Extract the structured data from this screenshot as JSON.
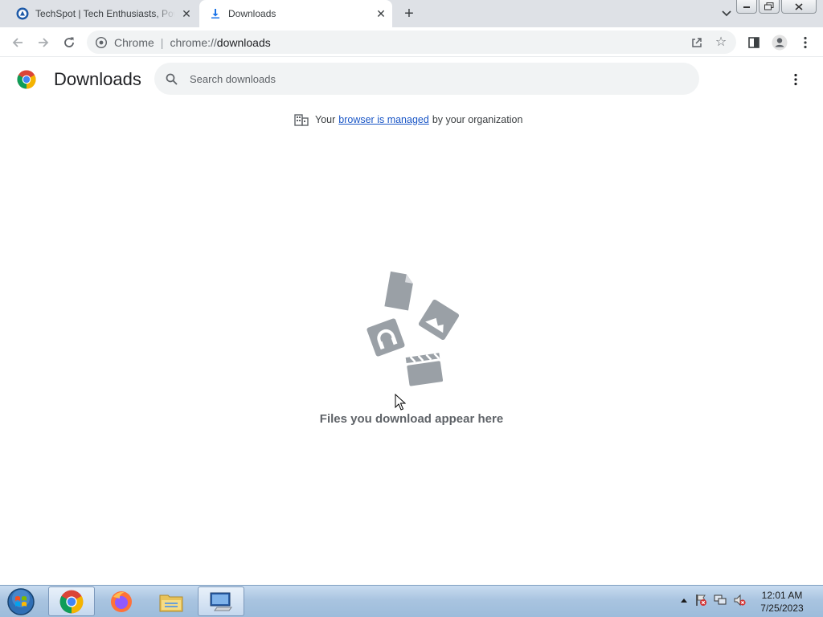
{
  "browser": {
    "tabs": [
      {
        "title": "TechSpot | Tech Enthusiasts, Power Users, Gamers",
        "active": false
      },
      {
        "title": "Downloads",
        "active": true
      }
    ],
    "omnibox": {
      "site_name": "Chrome",
      "separator": "|",
      "url_scheme": "chrome://",
      "url_path": "downloads"
    }
  },
  "page": {
    "title": "Downloads",
    "search_placeholder": "Search downloads",
    "managed_notice": {
      "prefix": "Your",
      "link": "browser is managed",
      "suffix": "by your organization"
    },
    "empty_message": "Files you download appear here"
  },
  "taskbar": {
    "items": [
      "start-orb",
      "chrome-icon",
      "firefox-icon",
      "file-explorer-icon",
      "remote-desktop-icon"
    ],
    "clock_time": "12:01 AM",
    "clock_date": "7/25/2023"
  },
  "colors": {
    "tabstrip": "#dee1e6",
    "link": "#1a56c6",
    "illustration": "#9aa0a6"
  }
}
